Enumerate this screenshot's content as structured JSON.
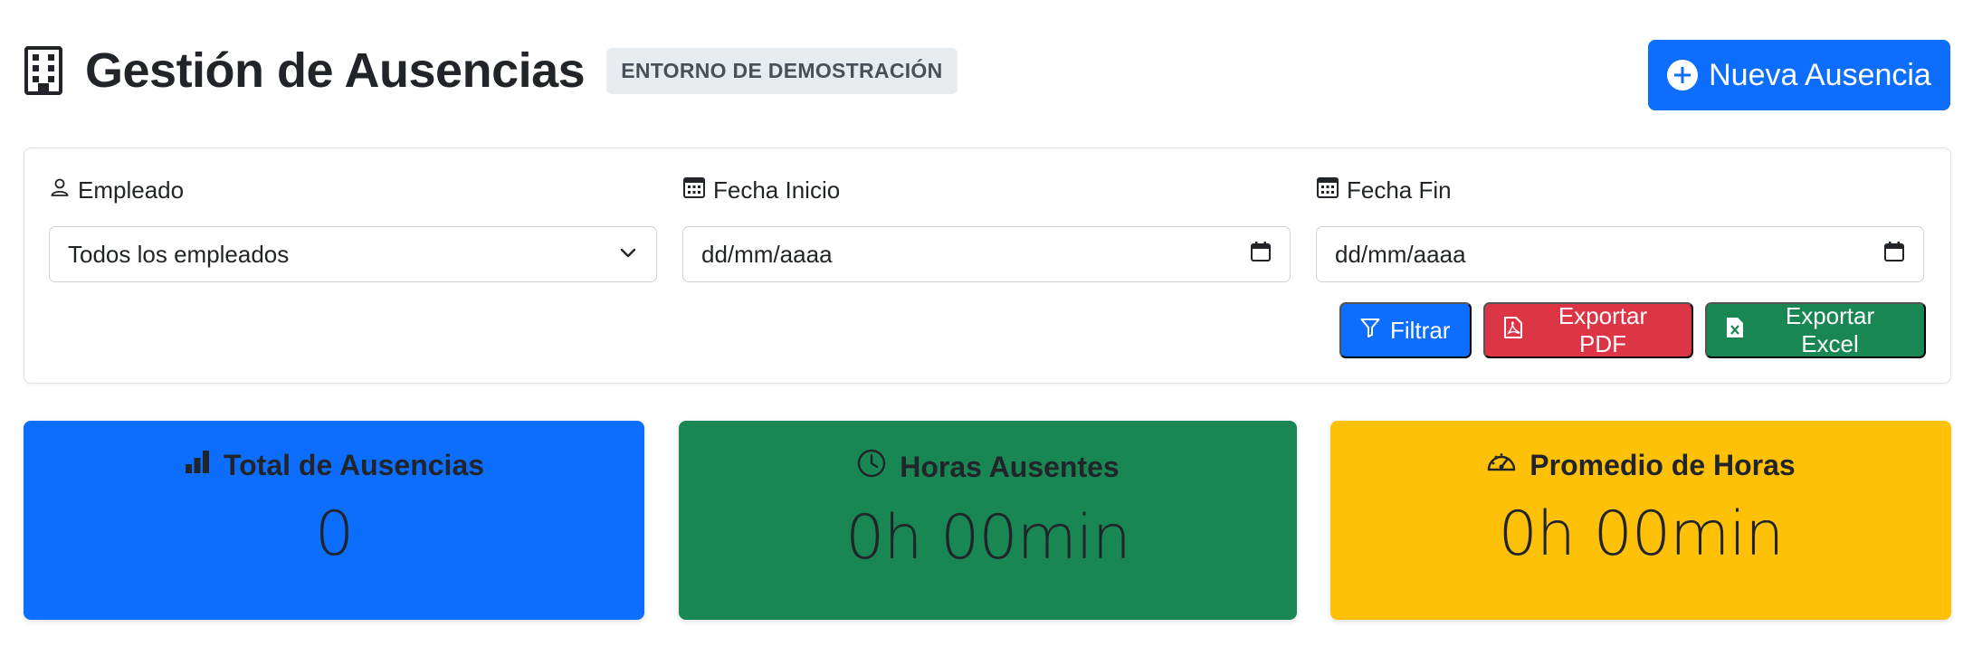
{
  "header": {
    "title": "Gestión de Ausencias",
    "environment_badge": "ENTORNO DE DEMOSTRACIÓN",
    "new_button_label": "Nueva Ausencia",
    "title_icon": "building-icon"
  },
  "filters": {
    "employee": {
      "label": "Empleado",
      "icon": "person-icon",
      "selected": "Todos los empleados"
    },
    "start_date": {
      "label": "Fecha Inicio",
      "icon": "calendar-icon",
      "value": "dd/mm/aaaa"
    },
    "end_date": {
      "label": "Fecha Fin",
      "icon": "calendar-icon",
      "value": "dd/mm/aaaa"
    },
    "buttons": {
      "filter": "Filtrar",
      "export_pdf": "Exportar PDF",
      "export_excel": "Exportar Excel"
    }
  },
  "stats": [
    {
      "title": "Total de Ausencias",
      "value": "0",
      "icon": "bar-chart-icon",
      "color": "#0d6efd"
    },
    {
      "title": "Horas Ausentes",
      "value": "0h 00min",
      "icon": "clock-icon",
      "color": "#198754"
    },
    {
      "title": "Promedio de Horas",
      "value": "0h 00min",
      "icon": "speedometer-icon",
      "color": "#ffc107"
    }
  ],
  "colors": {
    "primary": "#0d6efd",
    "danger": "#dc3545",
    "success": "#198754",
    "warning": "#ffc107"
  }
}
